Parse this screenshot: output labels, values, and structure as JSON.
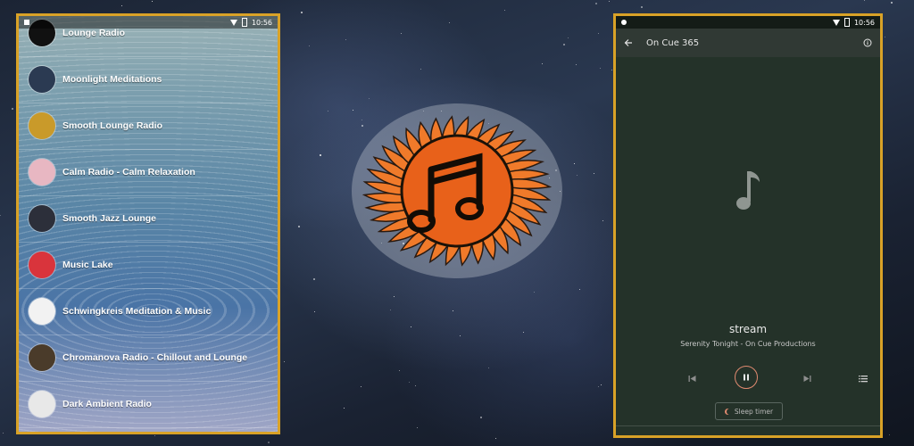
{
  "left_phone": {
    "status": {
      "time": "10:56"
    },
    "stations": [
      {
        "name": "Lounge Radio",
        "logo_color": "#111111"
      },
      {
        "name": "Moonlight Meditations",
        "logo_color": "#2b3a52"
      },
      {
        "name": "Smooth Lounge Radio",
        "logo_color": "#c99a2a"
      },
      {
        "name": "Calm Radio - Calm Relaxation",
        "logo_color": "#e8b7c2"
      },
      {
        "name": "Smooth Jazz Lounge",
        "logo_color": "#2c2f3a"
      },
      {
        "name": "Music Lake",
        "logo_color": "#d9343c"
      },
      {
        "name": "Schwingkreis Meditation & Music",
        "logo_color": "#f2f2f2"
      },
      {
        "name": "Chromanova Radio - Chillout and Lounge",
        "logo_color": "#4a3b2a"
      },
      {
        "name": "Dark Ambient Radio",
        "logo_color": "#e8e8e8"
      }
    ]
  },
  "right_phone": {
    "status": {
      "time": "10:56"
    },
    "appbar": {
      "title": "On Cue 365",
      "back_icon": "arrow-left-icon",
      "info_icon": "info-icon"
    },
    "now_playing": {
      "title": "stream",
      "subtitle": "Serenity Tonight - On Cue Productions",
      "art_icon": "music-note-icon"
    },
    "controls": {
      "prev_icon": "skip-previous-icon",
      "play_pause_icon": "pause-icon",
      "next_icon": "skip-next-icon",
      "queue_icon": "queue-list-icon"
    },
    "sleep_timer_label": "Sleep timer"
  },
  "emblem": {
    "icon": "music-sun-emblem",
    "ray_color": "#f07a2a",
    "center_color": "#e8611a"
  },
  "colors": {
    "frame": "#d9a227",
    "player_bg": "#243229",
    "accent": "#e08a70"
  }
}
